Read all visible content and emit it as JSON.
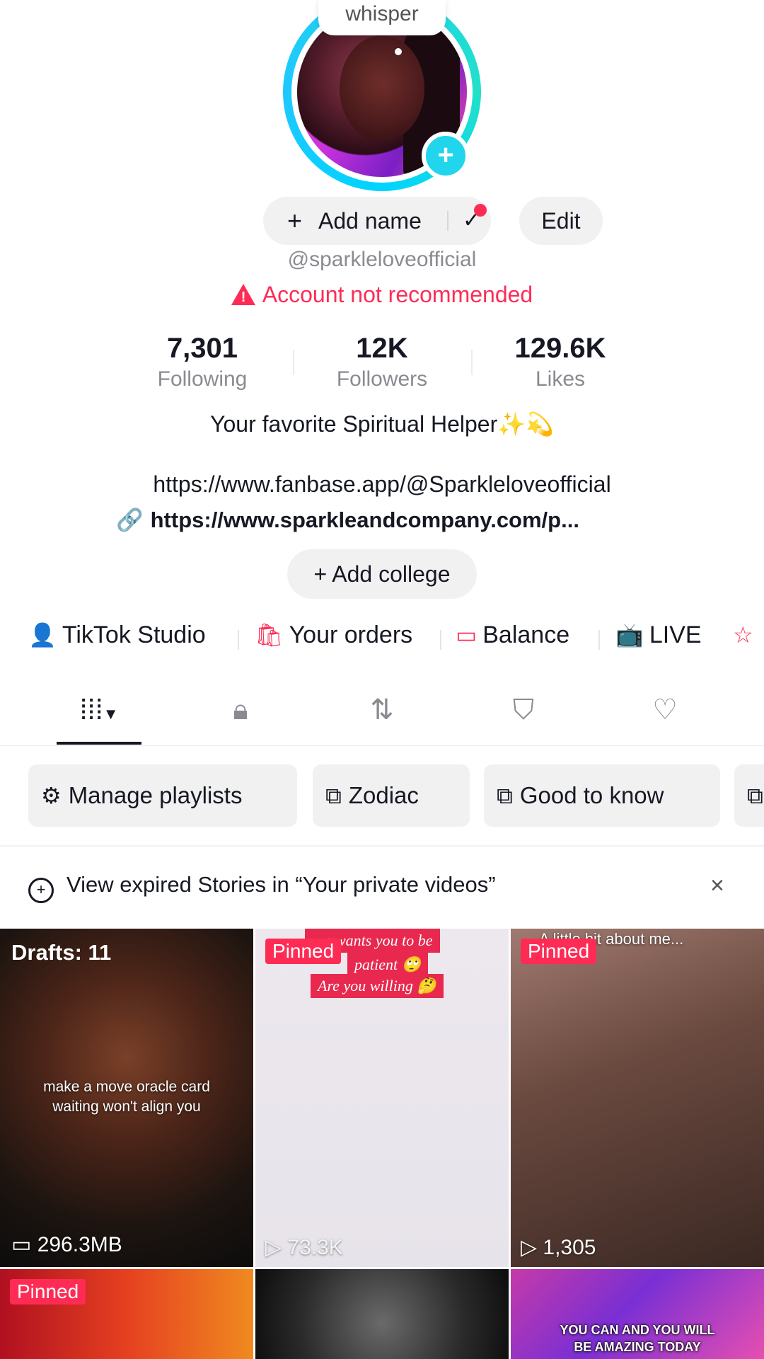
{
  "avatar": {
    "whisper_label": "whisper",
    "add_symbol": "+"
  },
  "actions": {
    "add_name_plus": "+",
    "add_name_label": "Add name",
    "check_symbol": "✓",
    "edit_label": "Edit"
  },
  "profile": {
    "handle": "@sparkleloveofficial",
    "warning": "Account not recommended",
    "bio": "Your favorite Spiritual Helper✨💫",
    "link1": "https://www.fanbase.app/@Sparkleloveofficial",
    "link2": "https://www.sparkleandcompany.com/p...",
    "add_college": "+ Add college"
  },
  "stats": [
    {
      "value": "7,301",
      "label": "Following"
    },
    {
      "value": "12K",
      "label": "Followers"
    },
    {
      "value": "129.6K",
      "label": "Likes"
    }
  ],
  "shortcuts": [
    {
      "label": "TikTok Studio",
      "icon": "studio-icon"
    },
    {
      "label": "Your orders",
      "icon": "orders-icon"
    },
    {
      "label": "Balance",
      "icon": "wallet-icon"
    },
    {
      "label": "LIVE",
      "icon": "live-icon"
    }
  ],
  "tabs": [
    "videos-grid-icon",
    "lock-icon",
    "repost-icon",
    "bookmark-icon",
    "heart-icon"
  ],
  "playlists": [
    {
      "label": "Manage playlists",
      "icon": "gear-icon"
    },
    {
      "label": "Zodiac",
      "icon": "playlist-icon"
    },
    {
      "label": "Good to know",
      "icon": "playlist-icon"
    }
  ],
  "notice": {
    "text": "View expired Stories in “Your private videos”",
    "close": "×"
  },
  "grid": {
    "drafts": "Drafts: 11",
    "storage": "296.3MB",
    "caption1_line1": "make a move oracle card",
    "caption1_line2": "waiting won't align you",
    "pinned": "Pinned",
    "caption2_line1": "...n wants you to be",
    "caption2_line2": "patient 🙄",
    "caption2_line3": "Are you willing 🤔",
    "views2": "73.3K",
    "caption3": "A little bit about me...",
    "views3": "1,305",
    "caption6_line1": "YOU CAN AND YOU WILL",
    "caption6_line2": "BE AMAZING TODAY"
  },
  "colors": {
    "accent": "#fe2c55",
    "ring": "#20d5ec",
    "text": "#161823",
    "muted": "#8a8b91"
  }
}
